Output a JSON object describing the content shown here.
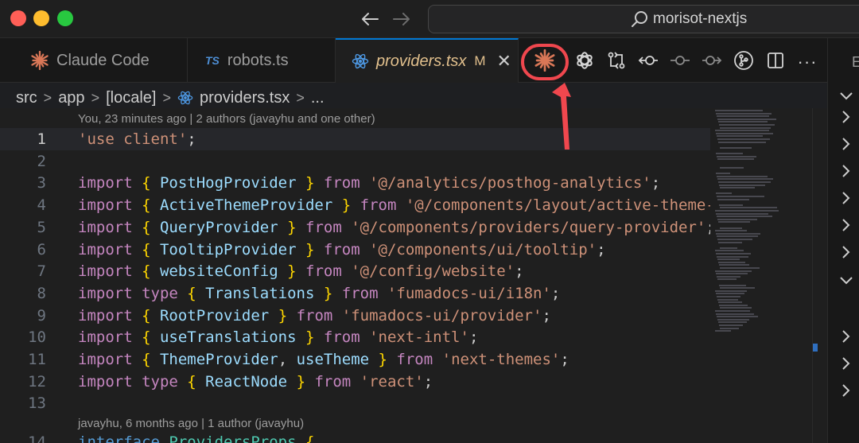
{
  "search": {
    "text": "morisot-nextjs"
  },
  "tabs": [
    {
      "label": "Claude Code",
      "icon": "claude-sparkle-icon"
    },
    {
      "label": "robots.ts",
      "badge": "TS"
    },
    {
      "label": "providers.tsx",
      "modified": "M",
      "close": "✕",
      "icon": "react-icon"
    }
  ],
  "actions": [
    "claude-code-icon",
    "openai-icon",
    "git-compare-icon",
    "go-back-icon",
    "git-commit-icon",
    "go-forward-icon",
    "source-control-icon",
    "split-editor-icon",
    "more-actions-icon"
  ],
  "more_label": "···",
  "rightpane": {
    "label": "E"
  },
  "breadcrumb": {
    "parts": [
      "src",
      "app",
      "[locale]",
      "providers.tsx",
      "..."
    ],
    "sep": ">"
  },
  "editor": {
    "blame_top": "You, 23 minutes ago | 2 authors (javayhu and one other)",
    "blame_bottom": "javayhu, 6 months ago | 1 author (javayhu)",
    "line_numbers": [
      "1",
      "2",
      "3",
      "4",
      "5",
      "6",
      "7",
      "8",
      "9",
      "10",
      "11",
      "12",
      "13",
      "14"
    ],
    "lines": [
      {
        "tokens": [
          {
            "t": "'use client'",
            "c": "str"
          },
          {
            "t": ";",
            "c": "pl"
          }
        ]
      },
      {
        "tokens": []
      },
      {
        "tokens": [
          {
            "t": "import ",
            "c": "kw"
          },
          {
            "t": "{ ",
            "c": "br"
          },
          {
            "t": "PostHogProvider",
            "c": "id"
          },
          {
            "t": " }",
            "c": "br"
          },
          {
            "t": " from ",
            "c": "kw"
          },
          {
            "t": "'@/analytics/posthog-analytics'",
            "c": "str"
          },
          {
            "t": ";",
            "c": "pl"
          }
        ]
      },
      {
        "tokens": [
          {
            "t": "import ",
            "c": "kw"
          },
          {
            "t": "{ ",
            "c": "br"
          },
          {
            "t": "ActiveThemeProvider",
            "c": "id"
          },
          {
            "t": " }",
            "c": "br"
          },
          {
            "t": " from ",
            "c": "kw"
          },
          {
            "t": "'@/components/layout/active-theme-pr",
            "c": "str"
          }
        ]
      },
      {
        "tokens": [
          {
            "t": "import ",
            "c": "kw"
          },
          {
            "t": "{ ",
            "c": "br"
          },
          {
            "t": "QueryProvider",
            "c": "id"
          },
          {
            "t": " }",
            "c": "br"
          },
          {
            "t": " from ",
            "c": "kw"
          },
          {
            "t": "'@/components/providers/query-provider'",
            "c": "str"
          },
          {
            "t": ";",
            "c": "pl"
          }
        ]
      },
      {
        "tokens": [
          {
            "t": "import ",
            "c": "kw"
          },
          {
            "t": "{ ",
            "c": "br"
          },
          {
            "t": "TooltipProvider",
            "c": "id"
          },
          {
            "t": " }",
            "c": "br"
          },
          {
            "t": " from ",
            "c": "kw"
          },
          {
            "t": "'@/components/ui/tooltip'",
            "c": "str"
          },
          {
            "t": ";",
            "c": "pl"
          }
        ]
      },
      {
        "tokens": [
          {
            "t": "import ",
            "c": "kw"
          },
          {
            "t": "{ ",
            "c": "br"
          },
          {
            "t": "websiteConfig",
            "c": "id"
          },
          {
            "t": " }",
            "c": "br"
          },
          {
            "t": " from ",
            "c": "kw"
          },
          {
            "t": "'@/config/website'",
            "c": "str"
          },
          {
            "t": ";",
            "c": "pl"
          }
        ]
      },
      {
        "tokens": [
          {
            "t": "import ",
            "c": "kw"
          },
          {
            "t": "type ",
            "c": "kw"
          },
          {
            "t": "{ ",
            "c": "br"
          },
          {
            "t": "Translations",
            "c": "id"
          },
          {
            "t": " }",
            "c": "br"
          },
          {
            "t": " from ",
            "c": "kw"
          },
          {
            "t": "'fumadocs-ui/i18n'",
            "c": "str"
          },
          {
            "t": ";",
            "c": "pl"
          }
        ]
      },
      {
        "tokens": [
          {
            "t": "import ",
            "c": "kw"
          },
          {
            "t": "{ ",
            "c": "br"
          },
          {
            "t": "RootProvider",
            "c": "id"
          },
          {
            "t": " }",
            "c": "br"
          },
          {
            "t": " from ",
            "c": "kw"
          },
          {
            "t": "'fumadocs-ui/provider'",
            "c": "str"
          },
          {
            "t": ";",
            "c": "pl"
          }
        ]
      },
      {
        "tokens": [
          {
            "t": "import ",
            "c": "kw"
          },
          {
            "t": "{ ",
            "c": "br"
          },
          {
            "t": "useTranslations",
            "c": "id"
          },
          {
            "t": " }",
            "c": "br"
          },
          {
            "t": " from ",
            "c": "kw"
          },
          {
            "t": "'next-intl'",
            "c": "str"
          },
          {
            "t": ";",
            "c": "pl"
          }
        ]
      },
      {
        "tokens": [
          {
            "t": "import ",
            "c": "kw"
          },
          {
            "t": "{ ",
            "c": "br"
          },
          {
            "t": "ThemeProvider",
            "c": "id"
          },
          {
            "t": ", ",
            "c": "pl"
          },
          {
            "t": "useTheme",
            "c": "id"
          },
          {
            "t": " }",
            "c": "br"
          },
          {
            "t": " from ",
            "c": "kw"
          },
          {
            "t": "'next-themes'",
            "c": "str"
          },
          {
            "t": ";",
            "c": "pl"
          }
        ]
      },
      {
        "tokens": [
          {
            "t": "import ",
            "c": "kw"
          },
          {
            "t": "type ",
            "c": "kw"
          },
          {
            "t": "{ ",
            "c": "br"
          },
          {
            "t": "ReactNode",
            "c": "id"
          },
          {
            "t": " }",
            "c": "br"
          },
          {
            "t": " from ",
            "c": "kw"
          },
          {
            "t": "'react'",
            "c": "str"
          },
          {
            "t": ";",
            "c": "pl"
          }
        ]
      },
      {
        "tokens": []
      },
      {
        "tokens": [
          {
            "t": "interface ",
            "c": "kw2"
          },
          {
            "t": "ProvidersProps ",
            "c": "ty"
          },
          {
            "t": "{",
            "c": "br"
          }
        ]
      }
    ]
  },
  "colors": {
    "accent": "#0078d4",
    "highlight": "#f0474e",
    "claude": "#d97757"
  }
}
